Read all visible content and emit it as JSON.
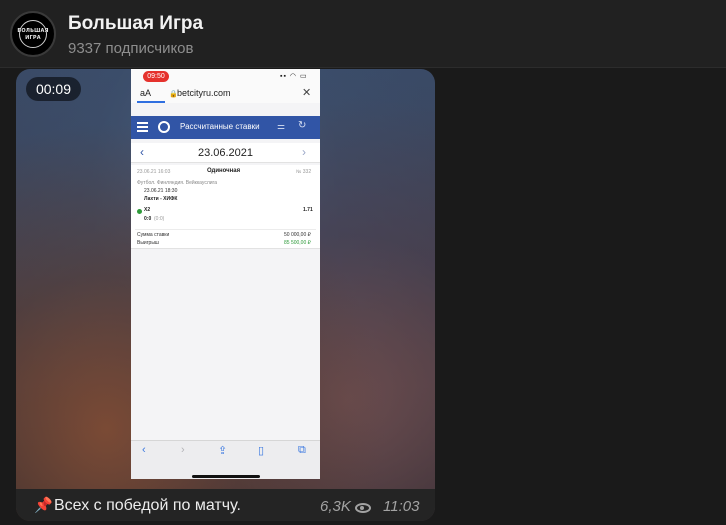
{
  "channel": {
    "title": "Большая Игра",
    "subscribers": "9337 подписчиков",
    "avatar_text_top": "БОЛЬШАЯ",
    "avatar_text_bottom": "ИГРА"
  },
  "message": {
    "duration": "00:09",
    "caption_icon": "pushpin-icon",
    "caption": "Всех с победой по матчу.",
    "views": "6,3K",
    "time": "11:03"
  },
  "phone": {
    "status_time": "09:50",
    "aa": "aA",
    "url": "betcityru.com",
    "app_title": "Рассчитанные ставки",
    "date": "23.06.2021",
    "bet": {
      "datetime": "23.06.21 16:03",
      "type": "Одиночная",
      "number": "№ 332",
      "league": "Футбол. Финляндия. Вейккауслига",
      "match_time": "23.06.21 18:30",
      "teams": "Лахти - ХИФК",
      "outcome": "X2",
      "odds": "1.71",
      "score": "0:0",
      "score_extra": "(0:0)",
      "stake_label": "Сумма ставки",
      "stake_value": "50 000,00 ₽",
      "win_label": "Выигрыш",
      "win_value": "85 500,00 ₽"
    }
  },
  "colors": {
    "accent_blue": "#3155a6",
    "win_green": "#2e9a3a",
    "status_red": "#e5322d"
  }
}
